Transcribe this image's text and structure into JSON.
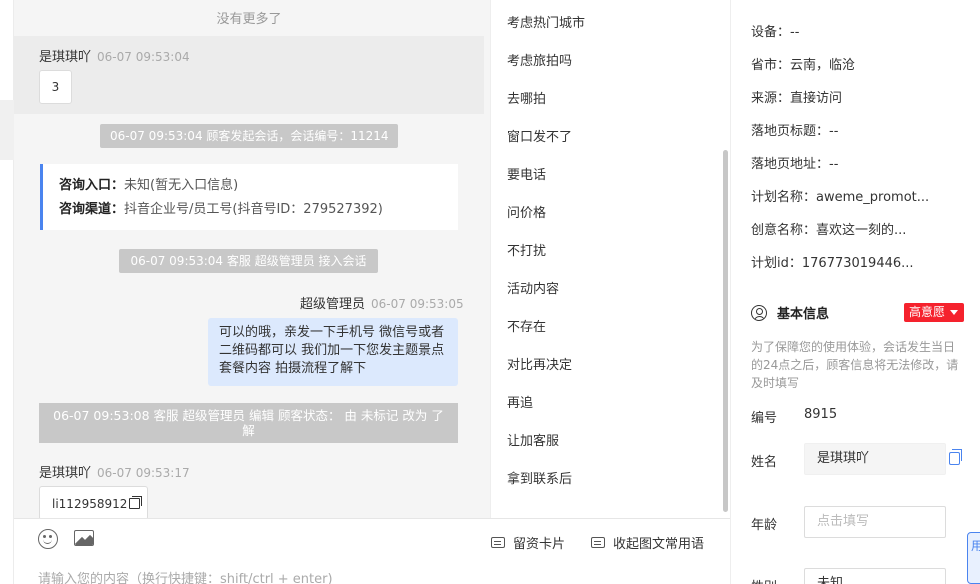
{
  "chat": {
    "no_more": "没有更多了",
    "msg1": {
      "sender": "是琪琪吖",
      "time": "06-07 09:53:04",
      "content": "3"
    },
    "sys1": "06-07 09:53:04 顾客发起会话，会话编号：11214",
    "info": {
      "entry_label": "咨询入口：",
      "entry_value": "未知(暂无入口信息)",
      "channel_label": "咨询渠道：",
      "channel_value": "抖音企业号/员工号(抖音号ID：279527392)"
    },
    "sys2": "06-07 09:53:04 客服 超级管理员 接入会话",
    "msg2": {
      "sender": "超级管理员",
      "time": "06-07 09:53:05",
      "line1": "可以的哦，亲发一下手机号 微信号或者",
      "line2": "二维码都可以 我们加一下您发主题景点",
      "line3": "套餐内容 拍摄流程了解下"
    },
    "sys3_line1": "06-07 09:53:08 客服 超级管理员 编辑 顾客状态： 由 未标记 改为 了",
    "sys3_line2": "解",
    "msg3": {
      "sender": "是琪琪吖",
      "time": "06-07 09:53:17",
      "content": "li112958912"
    }
  },
  "input": {
    "card_button": "留资卡片",
    "collapse_button": "收起图文常用语",
    "placeholder": "请输入您的内容（换行快捷键：shift/ctrl + enter)"
  },
  "quick_replies": [
    "考虑热门城市",
    "考虑旅拍吗",
    "去哪拍",
    "窗口发不了",
    "要电话",
    "问价格",
    "不打扰",
    "活动内容",
    "不存在",
    "对比再决定",
    "再追",
    "让加客服",
    "拿到联系后"
  ],
  "details": [
    {
      "label": "设备：",
      "value": "--"
    },
    {
      "label": "省市：",
      "value": "云南，临沧"
    },
    {
      "label": "来源：",
      "value": "直接访问"
    },
    {
      "label": "落地页标题：",
      "value": "--"
    },
    {
      "label": "落地页地址：",
      "value": "--"
    },
    {
      "label": "计划名称：",
      "value": "aweme_promot..."
    },
    {
      "label": "创意名称：",
      "value": "喜欢这一刻的..."
    },
    {
      "label": "计划id：",
      "value": "176773019446..."
    }
  ],
  "basic": {
    "title": "基本信息",
    "intent": "高意愿",
    "notice": "为了保障您的使用体验，会话发生当日的24点之后，顾客信息将无法修改，请及时填写",
    "id_label": "编号",
    "id_value": "8915",
    "name_label": "姓名",
    "name_value": "是琪琪吖",
    "age_label": "年龄",
    "age_placeholder": "点击填写",
    "gender_label": "性别",
    "gender_value": "未知"
  },
  "float_label": "用"
}
